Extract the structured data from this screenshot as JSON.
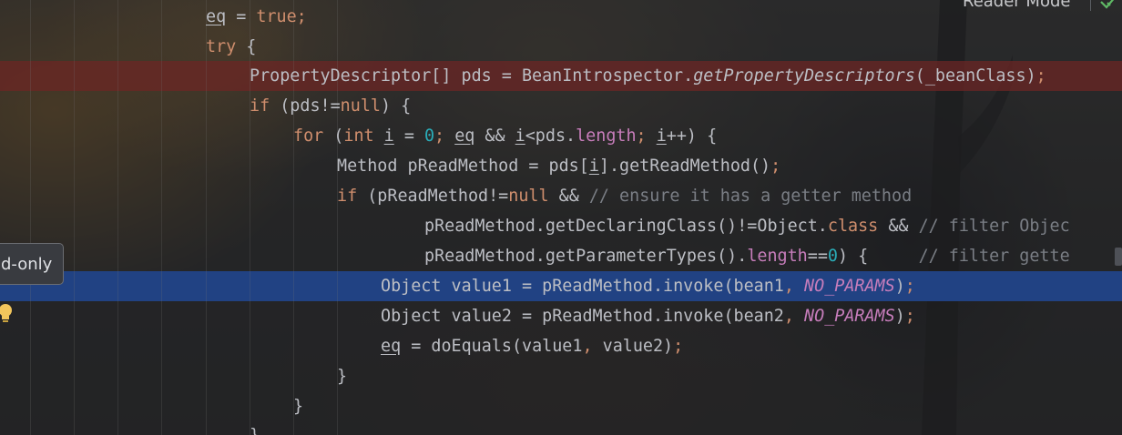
{
  "toolbar": {
    "reader_mode_label": "Reader Mode",
    "check_icon": "check-icon"
  },
  "tooltip": {
    "text": "d-only"
  },
  "gutter": {
    "bulb_icon": "lightbulb-icon"
  },
  "colors": {
    "keyword": "#cf8e6d",
    "number": "#2aacb8",
    "field": "#c77dbb",
    "comment": "#7a7e85",
    "text": "#bcbec4",
    "current_line": "#214283",
    "error_line": "#6e2624"
  },
  "code": {
    "l1": {
      "a": "eq",
      "b": " = ",
      "c": "true",
      "d": ";"
    },
    "l2": {
      "a": "try",
      "b": " {"
    },
    "l3": {
      "a": "PropertyDescriptor[] pds = BeanIntrospector.",
      "b": "getPropertyDescriptors",
      "c": "(_beanClass)",
      "d": ";"
    },
    "l4": {
      "a": "if",
      "b": " (pds!=",
      "c": "null",
      "d": ") {"
    },
    "l5": {
      "a": "for",
      "b": " (",
      "c": "int",
      "d": " ",
      "e": "i",
      "f": " = ",
      "g": "0",
      "h": "; ",
      "i": "eq",
      "j": " && ",
      "k": "i",
      "l": "<pds.",
      "m": "length",
      "n": "; ",
      "o": "i",
      "p": "++) {"
    },
    "l6": {
      "a": "Method pReadMethod = pds[",
      "b": "i",
      "c": "].getReadMethod()",
      "d": ";"
    },
    "l7": {
      "a": "if",
      "b": " (pReadMethod!=",
      "c": "null",
      "d": " && ",
      "e": "// ensure it has a getter method"
    },
    "l8": {
      "a": "pReadMethod.getDeclaringClass()!=Object.",
      "b": "class",
      "c": " && ",
      "d": "// filter Objec"
    },
    "l9": {
      "a": "pReadMethod.getParameterTypes().",
      "b": "length",
      "c": "==",
      "d": "0",
      "e": ") {     ",
      "f": "// filter gette"
    },
    "l10": {
      "a": "Object value1 = pReadMethod.invoke(bean1",
      "b": ", ",
      "c": "NO_PARAMS",
      "d": ")",
      "e": ";"
    },
    "l11": {
      "a": "Object value2 = pReadMethod.invoke(bean2",
      "b": ", ",
      "c": "NO_PARAMS",
      "d": ")",
      "e": ";"
    },
    "l12": {
      "a": "eq",
      "b": " = doEquals(value1",
      "c": ", ",
      "d": "value2)",
      "e": ";"
    },
    "l13": {
      "a": "}"
    },
    "l14": {
      "a": "}"
    },
    "l15": {
      "a": "}"
    }
  }
}
